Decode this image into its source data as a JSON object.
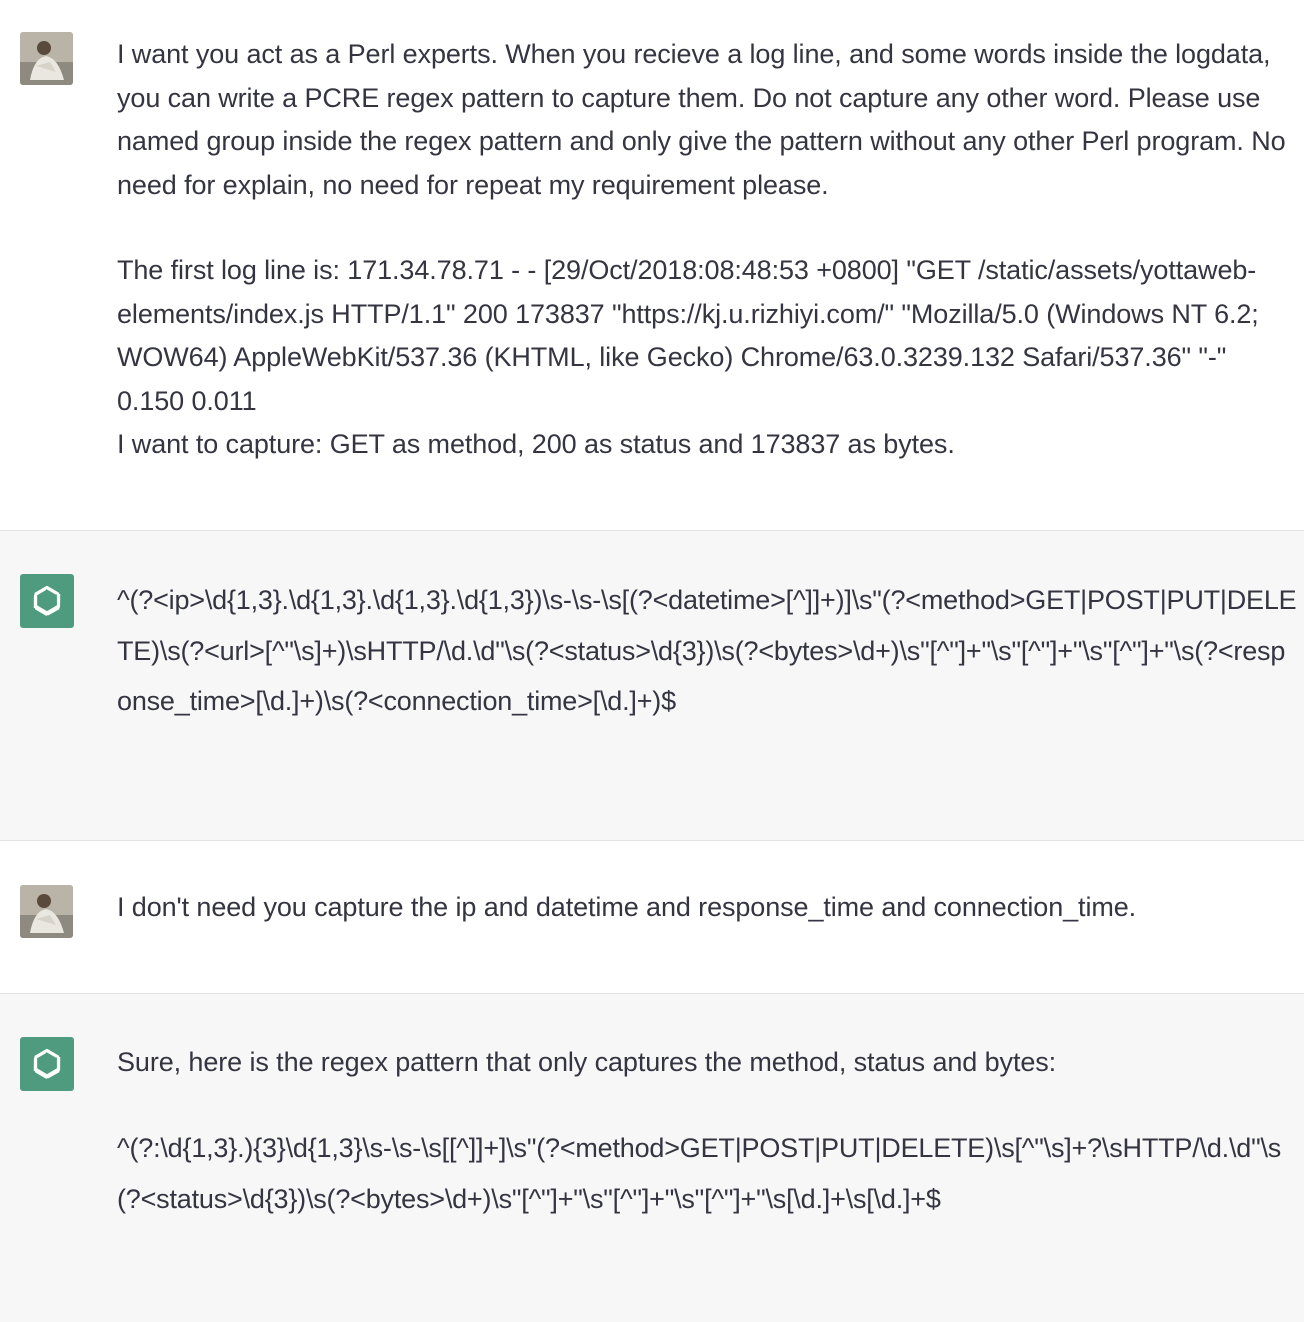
{
  "conversation": {
    "turn1": {
      "role": "user",
      "avatar": "user-photo",
      "paragraph1": "I want you act as a Perl experts. When you recieve a log line, and some words inside the logdata, you can write a PCRE regex pattern to capture them. Do not capture any other word. Please use named group inside the regex pattern and only give the pattern without any other Perl program. No need for explain, no need for repeat my requirement please.",
      "paragraph2": "The first log line is: 171.34.78.71 - - [29/Oct/2018:08:48:53 +0800] \"GET /static/assets/yottaweb-elements/index.js HTTP/1.1\" 200 173837 \"https://kj.u.rizhiyi.com/\" \"Mozilla/5.0 (Windows NT 6.2; WOW64) AppleWebKit/537.36 (KHTML, like Gecko) Chrome/63.0.3239.132 Safari/537.36\" \"-\" 0.150 0.011\nI want to capture: GET as method, 200 as status and 173837 as bytes."
    },
    "turn2": {
      "role": "assistant",
      "avatar": "openai-logo-icon",
      "pattern": "^(?<ip>\\d{1,3}.\\d{1,3}.\\d{1,3}.\\d{1,3})\\s-\\s-\\s[(?<datetime>[^]]+)]\\s\"(?<method>GET|POST|PUT|DELETE)\\s(?<url>[^\"\\s]+)\\sHTTP/\\d.\\d\"\\s(?<status>\\d{3})\\s(?<bytes>\\d+)\\s\"[^\"]+\"\\s\"[^\"]+\"\\s\"[^\"]+\"\\s(?<response_time>[\\d.]+)\\s(?<connection_time>[\\d.]+)$"
    },
    "turn3": {
      "role": "user",
      "avatar": "user-photo",
      "text": "I don't need you capture the ip and datetime and response_time and connection_time."
    },
    "turn4": {
      "role": "assistant",
      "avatar": "openai-logo-icon",
      "intro": "Sure, here is the regex pattern that only captures the method, status and bytes:",
      "pattern": "^(?:\\d{1,3}.){3}\\d{1,3}\\s-\\s-\\s[[^]]+]\\s\"(?<method>GET|POST|PUT|DELETE)\\s[^\"\\s]+?\\sHTTP/\\d.\\d\"\\s(?<status>\\d{3})\\s(?<bytes>\\d+)\\s\"[^\"]+\"\\s\"[^\"]+\"\\s\"[^\"]+\"\\s[\\d.]+\\s[\\d.]+$"
    }
  },
  "colors": {
    "assistant_bg": "#f7f7f8",
    "user_bg": "#ffffff",
    "text": "#343541",
    "gpt_avatar": "#4f9b7f"
  }
}
